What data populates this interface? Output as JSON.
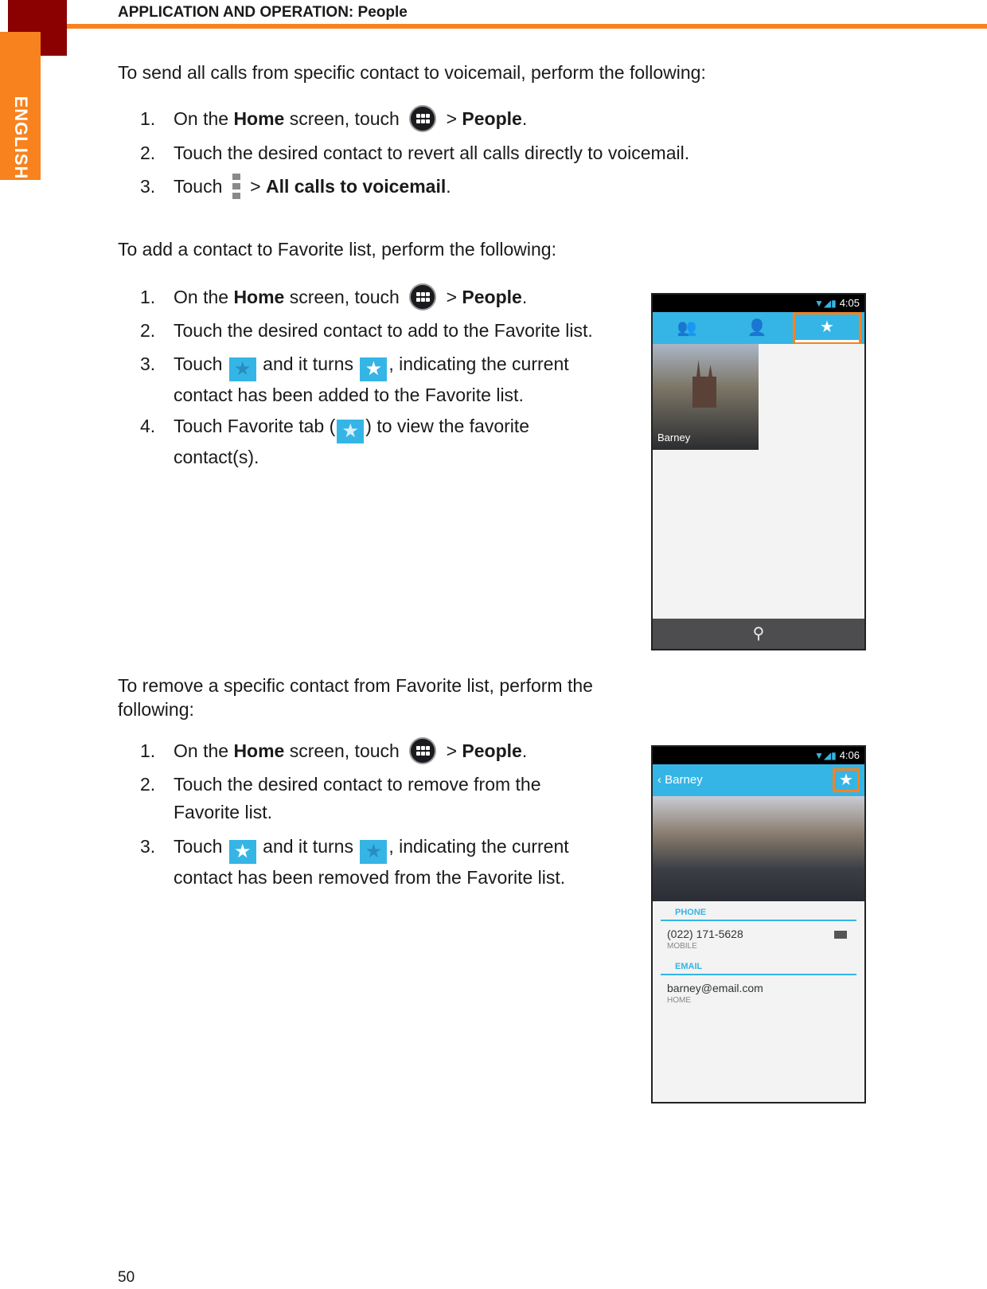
{
  "header": {
    "title": "APPLICATION AND OPERATION: People",
    "side_tab": "ENGLISH"
  },
  "section1": {
    "intro": "To send all calls from specific contact to voicemail, perform the following:",
    "steps": [
      {
        "num": "1.",
        "pre": "On the ",
        "bold1": "Home",
        "mid": " screen, touch ",
        "sep": " > ",
        "bold2": "People",
        "end": "."
      },
      {
        "num": "2.",
        "text": "Touch the desired contact to revert all calls directly to voicemail."
      },
      {
        "num": "3.",
        "pre": "Touch ",
        "sep": " > ",
        "bold": "All calls to voicemail",
        "end": "."
      }
    ]
  },
  "section2": {
    "intro": "To add a contact to Favorite list, perform the following:",
    "steps": [
      {
        "num": "1.",
        "pre": "On the ",
        "bold1": "Home",
        "mid": " screen, touch ",
        "sep": " > ",
        "bold2": "People",
        "end": "."
      },
      {
        "num": "2.",
        "text": "Touch the desired contact to add to the Favorite list."
      },
      {
        "num": "3.",
        "pre": "Touch ",
        "mid": " and it turns ",
        "post": ", indicating the current contact has been added to the Favorite list."
      },
      {
        "num": "4.",
        "pre": "Touch Favorite tab (",
        "post": ") to view the favorite contact(s)."
      }
    ]
  },
  "section3": {
    "intro": "To remove a specific contact from Favorite list, perform the following:",
    "steps": [
      {
        "num": "1.",
        "pre": "On the ",
        "bold1": "Home",
        "mid": " screen, touch ",
        "sep": " > ",
        "bold2": "People",
        "end": "."
      },
      {
        "num": "2.",
        "text": "Touch the desired contact to remove from the Favorite list."
      },
      {
        "num": "3.",
        "pre": "Touch ",
        "mid": " and it turns ",
        "post": ", indicating the current contact has been removed from the Favorite list."
      }
    ]
  },
  "phone1": {
    "time": "4:05",
    "contact_name": "Barney",
    "star": "★",
    "search": "⚲"
  },
  "phone2": {
    "time": "4:06",
    "back": "‹ Barney",
    "star": "★",
    "phone_label": "PHONE",
    "phone_value": "(022) 171-5628",
    "phone_type": "MOBILE",
    "email_label": "EMAIL",
    "email_value": "barney@email.com",
    "email_type": "HOME"
  },
  "glyphs": {
    "star": "★"
  },
  "page_number": "50"
}
